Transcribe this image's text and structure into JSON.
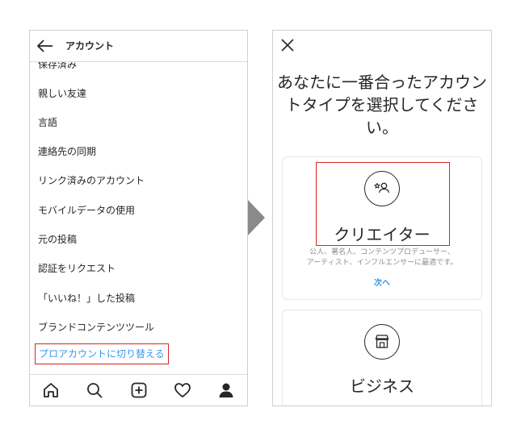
{
  "left_screen": {
    "header": {
      "title": "アカウント",
      "back_icon": "arrow-left-icon"
    },
    "menu_items": [
      "保存済み",
      "親しい友達",
      "言語",
      "連絡先の同期",
      "リンク済みのアカウント",
      "モバイルデータの使用",
      "元の投稿",
      "認証をリクエスト",
      "「いいね！」した投稿",
      "ブランドコンテンツツール"
    ],
    "pro_link": "プロアカウントに切り替える",
    "tabbar": [
      "home-icon",
      "search-icon",
      "add-post-icon",
      "heart-icon",
      "profile-icon"
    ]
  },
  "right_screen": {
    "close_icon": "close-icon",
    "heading_lines": [
      "あなたに一番合ったアカウン",
      "トタイプを選択してくださ",
      "い。"
    ],
    "creator_card": {
      "icon": "creator-icon",
      "title": "クリエイター",
      "desc_lines": [
        "公人、著名人、コンテンツプロデューサー、",
        "アーティスト、インフルエンサーに最適です。"
      ],
      "next": "次へ"
    },
    "business_card": {
      "icon": "store-icon",
      "title": "ビジネス"
    }
  },
  "colors": {
    "accent_link": "#3897f0",
    "highlight_box": "#d9251c",
    "arrow": "#8a8a8a"
  }
}
